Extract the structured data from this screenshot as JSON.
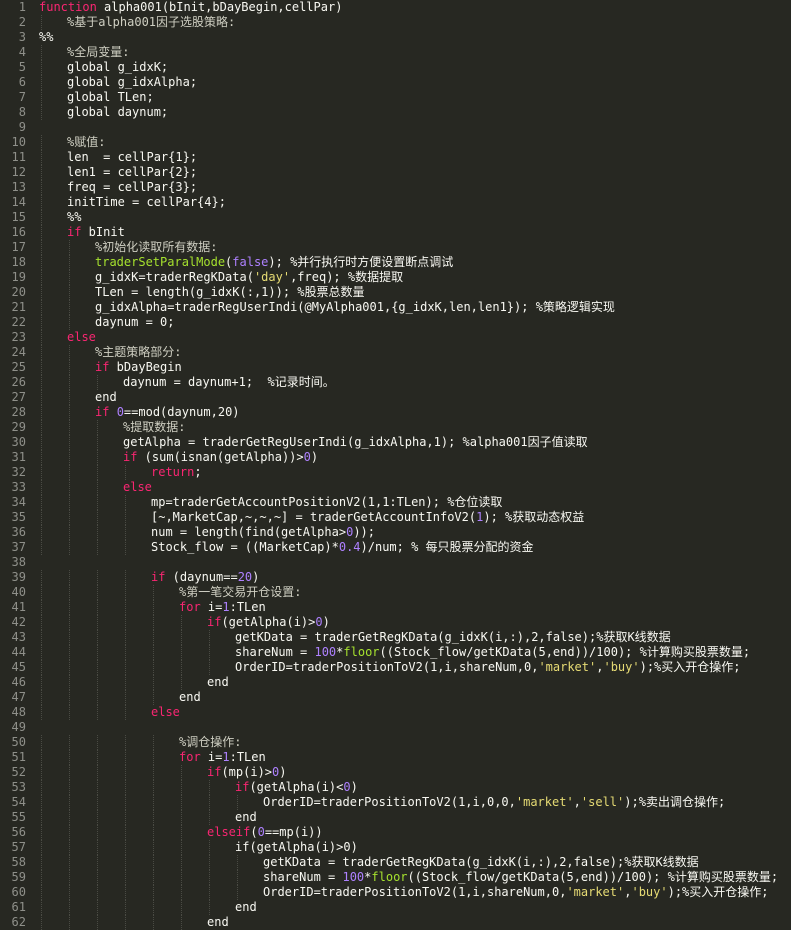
{
  "editor": {
    "language": "matlab",
    "colors": {
      "background": "#272822",
      "line_number": "#8f908a",
      "text": "#f8f8f2",
      "keyword": "#f92672",
      "function": "#a6e22e",
      "comment": "#cfcfc2",
      "number": "#ae81ff",
      "string": "#e6db74"
    },
    "lines": [
      {
        "n": "1",
        "indent": 0,
        "tokens": [
          {
            "t": "kw",
            "v": "function"
          },
          {
            "t": "p",
            "v": " alpha001(bInit,bDayBegin,cellPar)"
          }
        ]
      },
      {
        "n": "2",
        "indent": 1,
        "tokens": [
          {
            "t": "cm",
            "v": "%基于alpha001因子选股策略:"
          }
        ]
      },
      {
        "n": "3",
        "indent": 0,
        "tokens": [
          {
            "t": "sec",
            "v": "%%"
          }
        ]
      },
      {
        "n": "4",
        "indent": 1,
        "tokens": [
          {
            "t": "cm",
            "v": "%全局变量:"
          }
        ]
      },
      {
        "n": "5",
        "indent": 1,
        "tokens": [
          {
            "t": "p",
            "v": "global g_idxK;"
          }
        ]
      },
      {
        "n": "6",
        "indent": 1,
        "tokens": [
          {
            "t": "p",
            "v": "global g_idxAlpha;"
          }
        ]
      },
      {
        "n": "7",
        "indent": 1,
        "tokens": [
          {
            "t": "p",
            "v": "global TLen;"
          }
        ]
      },
      {
        "n": "8",
        "indent": 1,
        "tokens": [
          {
            "t": "p",
            "v": "global daynum;"
          }
        ]
      },
      {
        "n": "9",
        "indent": 0,
        "tokens": []
      },
      {
        "n": "10",
        "indent": 1,
        "tokens": [
          {
            "t": "cm",
            "v": "%赋值:"
          }
        ]
      },
      {
        "n": "11",
        "indent": 1,
        "tokens": [
          {
            "t": "p",
            "v": "len  = cellPar{1};"
          }
        ]
      },
      {
        "n": "12",
        "indent": 1,
        "tokens": [
          {
            "t": "p",
            "v": "len1 = cellPar{2};"
          }
        ]
      },
      {
        "n": "13",
        "indent": 1,
        "tokens": [
          {
            "t": "p",
            "v": "freq = cellPar{3};"
          }
        ]
      },
      {
        "n": "14",
        "indent": 1,
        "tokens": [
          {
            "t": "p",
            "v": "initTime = cellPar{4};"
          }
        ]
      },
      {
        "n": "15",
        "indent": 1,
        "tokens": [
          {
            "t": "sec",
            "v": "%%"
          }
        ]
      },
      {
        "n": "16",
        "indent": 1,
        "tokens": [
          {
            "t": "kw",
            "v": "if"
          },
          {
            "t": "p",
            "v": " bInit"
          }
        ]
      },
      {
        "n": "17",
        "indent": 2,
        "tokens": [
          {
            "t": "cm",
            "v": "%初始化读取所有数据:"
          }
        ]
      },
      {
        "n": "18",
        "indent": 2,
        "tokens": [
          {
            "t": "fn",
            "v": "traderSetParalMode"
          },
          {
            "t": "p",
            "v": "("
          },
          {
            "t": "lit",
            "v": "false"
          },
          {
            "t": "p",
            "v": "); %并行执行时方便设置断点调试"
          }
        ]
      },
      {
        "n": "19",
        "indent": 2,
        "tokens": [
          {
            "t": "p",
            "v": "g_idxK=traderRegKData("
          },
          {
            "t": "str",
            "v": "'day'"
          },
          {
            "t": "p",
            "v": ",freq); %数据提取"
          }
        ]
      },
      {
        "n": "20",
        "indent": 2,
        "tokens": [
          {
            "t": "p",
            "v": "TLen = length(g_idxK(:,1)); %股票总数量"
          }
        ]
      },
      {
        "n": "21",
        "indent": 2,
        "tokens": [
          {
            "t": "p",
            "v": "g_idxAlpha=traderRegUserIndi(@MyAlpha001,{g_idxK,len,len1}); %策略逻辑实现"
          }
        ]
      },
      {
        "n": "22",
        "indent": 2,
        "tokens": [
          {
            "t": "p",
            "v": "daynum = 0;"
          }
        ]
      },
      {
        "n": "23",
        "indent": 1,
        "tokens": [
          {
            "t": "kw",
            "v": "else"
          }
        ]
      },
      {
        "n": "24",
        "indent": 2,
        "tokens": [
          {
            "t": "cm",
            "v": "%主题策略部分:"
          }
        ]
      },
      {
        "n": "25",
        "indent": 2,
        "tokens": [
          {
            "t": "kw",
            "v": "if"
          },
          {
            "t": "p",
            "v": " bDayBegin"
          }
        ]
      },
      {
        "n": "26",
        "indent": 3,
        "tokens": [
          {
            "t": "p",
            "v": "daynum = daynum+1;  %记录时间。"
          }
        ]
      },
      {
        "n": "27",
        "indent": 2,
        "tokens": [
          {
            "t": "p",
            "v": "end"
          }
        ]
      },
      {
        "n": "28",
        "indent": 2,
        "tokens": [
          {
            "t": "kw",
            "v": "if"
          },
          {
            "t": "p",
            "v": " "
          },
          {
            "t": "num",
            "v": "0"
          },
          {
            "t": "p",
            "v": "==mod(daynum,20)"
          }
        ]
      },
      {
        "n": "29",
        "indent": 3,
        "tokens": [
          {
            "t": "cm",
            "v": "%提取数据:"
          }
        ]
      },
      {
        "n": "30",
        "indent": 3,
        "tokens": [
          {
            "t": "p",
            "v": "getAlpha = traderGetRegUserIndi(g_idxAlpha,1); %alpha001因子值读取"
          }
        ]
      },
      {
        "n": "31",
        "indent": 3,
        "tokens": [
          {
            "t": "kw",
            "v": "if"
          },
          {
            "t": "p",
            "v": " (sum(isnan(getAlpha))>"
          },
          {
            "t": "num",
            "v": "0"
          },
          {
            "t": "p",
            "v": ")"
          }
        ]
      },
      {
        "n": "32",
        "indent": 4,
        "tokens": [
          {
            "t": "kw",
            "v": "return"
          },
          {
            "t": "p",
            "v": ";"
          }
        ]
      },
      {
        "n": "33",
        "indent": 3,
        "tokens": [
          {
            "t": "kw",
            "v": "else"
          }
        ]
      },
      {
        "n": "34",
        "indent": 4,
        "tokens": [
          {
            "t": "p",
            "v": "mp=traderGetAccountPositionV2(1,1:TLen); %仓位读取"
          }
        ]
      },
      {
        "n": "35",
        "indent": 4,
        "tokens": [
          {
            "t": "p",
            "v": "[~,MarketCap,~,~,~] = traderGetAccountInfoV2("
          },
          {
            "t": "num",
            "v": "1"
          },
          {
            "t": "p",
            "v": "); %获取动态权益"
          }
        ]
      },
      {
        "n": "36",
        "indent": 4,
        "tokens": [
          {
            "t": "p",
            "v": "num = length(find(getAlpha>"
          },
          {
            "t": "num",
            "v": "0"
          },
          {
            "t": "p",
            "v": "));"
          }
        ]
      },
      {
        "n": "37",
        "indent": 4,
        "tokens": [
          {
            "t": "p",
            "v": "Stock_flow = ((MarketCap)*"
          },
          {
            "t": "num",
            "v": "0.4"
          },
          {
            "t": "p",
            "v": ")/num; % 每只股票分配的资金"
          }
        ]
      },
      {
        "n": "38",
        "indent": 0,
        "tokens": []
      },
      {
        "n": "39",
        "indent": 4,
        "tokens": [
          {
            "t": "kw",
            "v": "if"
          },
          {
            "t": "p",
            "v": " (daynum=="
          },
          {
            "t": "num",
            "v": "20"
          },
          {
            "t": "p",
            "v": ")"
          }
        ]
      },
      {
        "n": "40",
        "indent": 5,
        "tokens": [
          {
            "t": "cm",
            "v": "%第一笔交易开仓设置:"
          }
        ]
      },
      {
        "n": "41",
        "indent": 5,
        "tokens": [
          {
            "t": "kw",
            "v": "for"
          },
          {
            "t": "p",
            "v": " i="
          },
          {
            "t": "num",
            "v": "1"
          },
          {
            "t": "p",
            "v": ":TLen"
          }
        ]
      },
      {
        "n": "42",
        "indent": 6,
        "tokens": [
          {
            "t": "kw",
            "v": "if"
          },
          {
            "t": "p",
            "v": "(getAlpha(i)>"
          },
          {
            "t": "num",
            "v": "0"
          },
          {
            "t": "p",
            "v": ")"
          }
        ]
      },
      {
        "n": "43",
        "indent": 7,
        "tokens": [
          {
            "t": "p",
            "v": "getKData = traderGetRegKData(g_idxK(i,:),2,false);%获取K线数据"
          }
        ]
      },
      {
        "n": "44",
        "indent": 7,
        "tokens": [
          {
            "t": "p",
            "v": "shareNum = "
          },
          {
            "t": "num",
            "v": "100"
          },
          {
            "t": "p",
            "v": "*"
          },
          {
            "t": "fn",
            "v": "floor"
          },
          {
            "t": "p",
            "v": "((Stock_flow/getKData(5,end))/100); %计算购买股票数量;"
          }
        ]
      },
      {
        "n": "45",
        "indent": 7,
        "tokens": [
          {
            "t": "p",
            "v": "OrderID=traderPositionToV2(1,i,shareNum,0,"
          },
          {
            "t": "str",
            "v": "'market'"
          },
          {
            "t": "p",
            "v": ","
          },
          {
            "t": "str",
            "v": "'buy'"
          },
          {
            "t": "p",
            "v": ");%买入开仓操作;"
          }
        ]
      },
      {
        "n": "46",
        "indent": 6,
        "tokens": [
          {
            "t": "p",
            "v": "end"
          }
        ]
      },
      {
        "n": "47",
        "indent": 5,
        "tokens": [
          {
            "t": "p",
            "v": "end"
          }
        ]
      },
      {
        "n": "48",
        "indent": 4,
        "tokens": [
          {
            "t": "kw",
            "v": "else"
          }
        ]
      },
      {
        "n": "49",
        "indent": 0,
        "tokens": []
      },
      {
        "n": "50",
        "indent": 5,
        "tokens": [
          {
            "t": "cm",
            "v": "%调仓操作:"
          }
        ]
      },
      {
        "n": "51",
        "indent": 5,
        "tokens": [
          {
            "t": "kw",
            "v": "for"
          },
          {
            "t": "p",
            "v": " i="
          },
          {
            "t": "num",
            "v": "1"
          },
          {
            "t": "p",
            "v": ":TLen"
          }
        ]
      },
      {
        "n": "52",
        "indent": 6,
        "tokens": [
          {
            "t": "kw",
            "v": "if"
          },
          {
            "t": "p",
            "v": "(mp(i)>"
          },
          {
            "t": "num",
            "v": "0"
          },
          {
            "t": "p",
            "v": ")"
          }
        ]
      },
      {
        "n": "53",
        "indent": 7,
        "tokens": [
          {
            "t": "kw",
            "v": "if"
          },
          {
            "t": "p",
            "v": "(getAlpha(i)<"
          },
          {
            "t": "num",
            "v": "0"
          },
          {
            "t": "p",
            "v": ")"
          }
        ]
      },
      {
        "n": "54",
        "indent": 8,
        "tokens": [
          {
            "t": "p",
            "v": "OrderID=traderPositionToV2(1,i,0,0,"
          },
          {
            "t": "str",
            "v": "'market'"
          },
          {
            "t": "p",
            "v": ","
          },
          {
            "t": "str",
            "v": "'sell'"
          },
          {
            "t": "p",
            "v": ");%卖出调仓操作;"
          }
        ]
      },
      {
        "n": "55",
        "indent": 7,
        "tokens": [
          {
            "t": "p",
            "v": "end"
          }
        ]
      },
      {
        "n": "56",
        "indent": 6,
        "tokens": [
          {
            "t": "kw",
            "v": "elseif"
          },
          {
            "t": "p",
            "v": "("
          },
          {
            "t": "num",
            "v": "0"
          },
          {
            "t": "p",
            "v": "==mp(i))"
          }
        ]
      },
      {
        "n": "57",
        "indent": 7,
        "tokens": [
          {
            "t": "p",
            "v": "if(getAlpha(i)>0)"
          }
        ]
      },
      {
        "n": "58",
        "indent": 8,
        "tokens": [
          {
            "t": "p",
            "v": "getKData = traderGetRegKData(g_idxK(i,:),2,false);%获取K线数据"
          }
        ]
      },
      {
        "n": "59",
        "indent": 8,
        "tokens": [
          {
            "t": "p",
            "v": "shareNum = "
          },
          {
            "t": "num",
            "v": "100"
          },
          {
            "t": "p",
            "v": "*"
          },
          {
            "t": "fn",
            "v": "floor"
          },
          {
            "t": "p",
            "v": "((Stock_flow/getKData(5,end))/100); %计算购买股票数量;"
          }
        ]
      },
      {
        "n": "60",
        "indent": 8,
        "tokens": [
          {
            "t": "p",
            "v": "OrderID=traderPositionToV2(1,i,shareNum,0,"
          },
          {
            "t": "str",
            "v": "'market'"
          },
          {
            "t": "p",
            "v": ","
          },
          {
            "t": "str",
            "v": "'buy'"
          },
          {
            "t": "p",
            "v": ");%买入开仓操作;"
          }
        ]
      },
      {
        "n": "61",
        "indent": 7,
        "tokens": [
          {
            "t": "p",
            "v": "end"
          }
        ]
      },
      {
        "n": "62",
        "indent": 6,
        "tokens": [
          {
            "t": "p",
            "v": "end"
          }
        ]
      }
    ]
  }
}
